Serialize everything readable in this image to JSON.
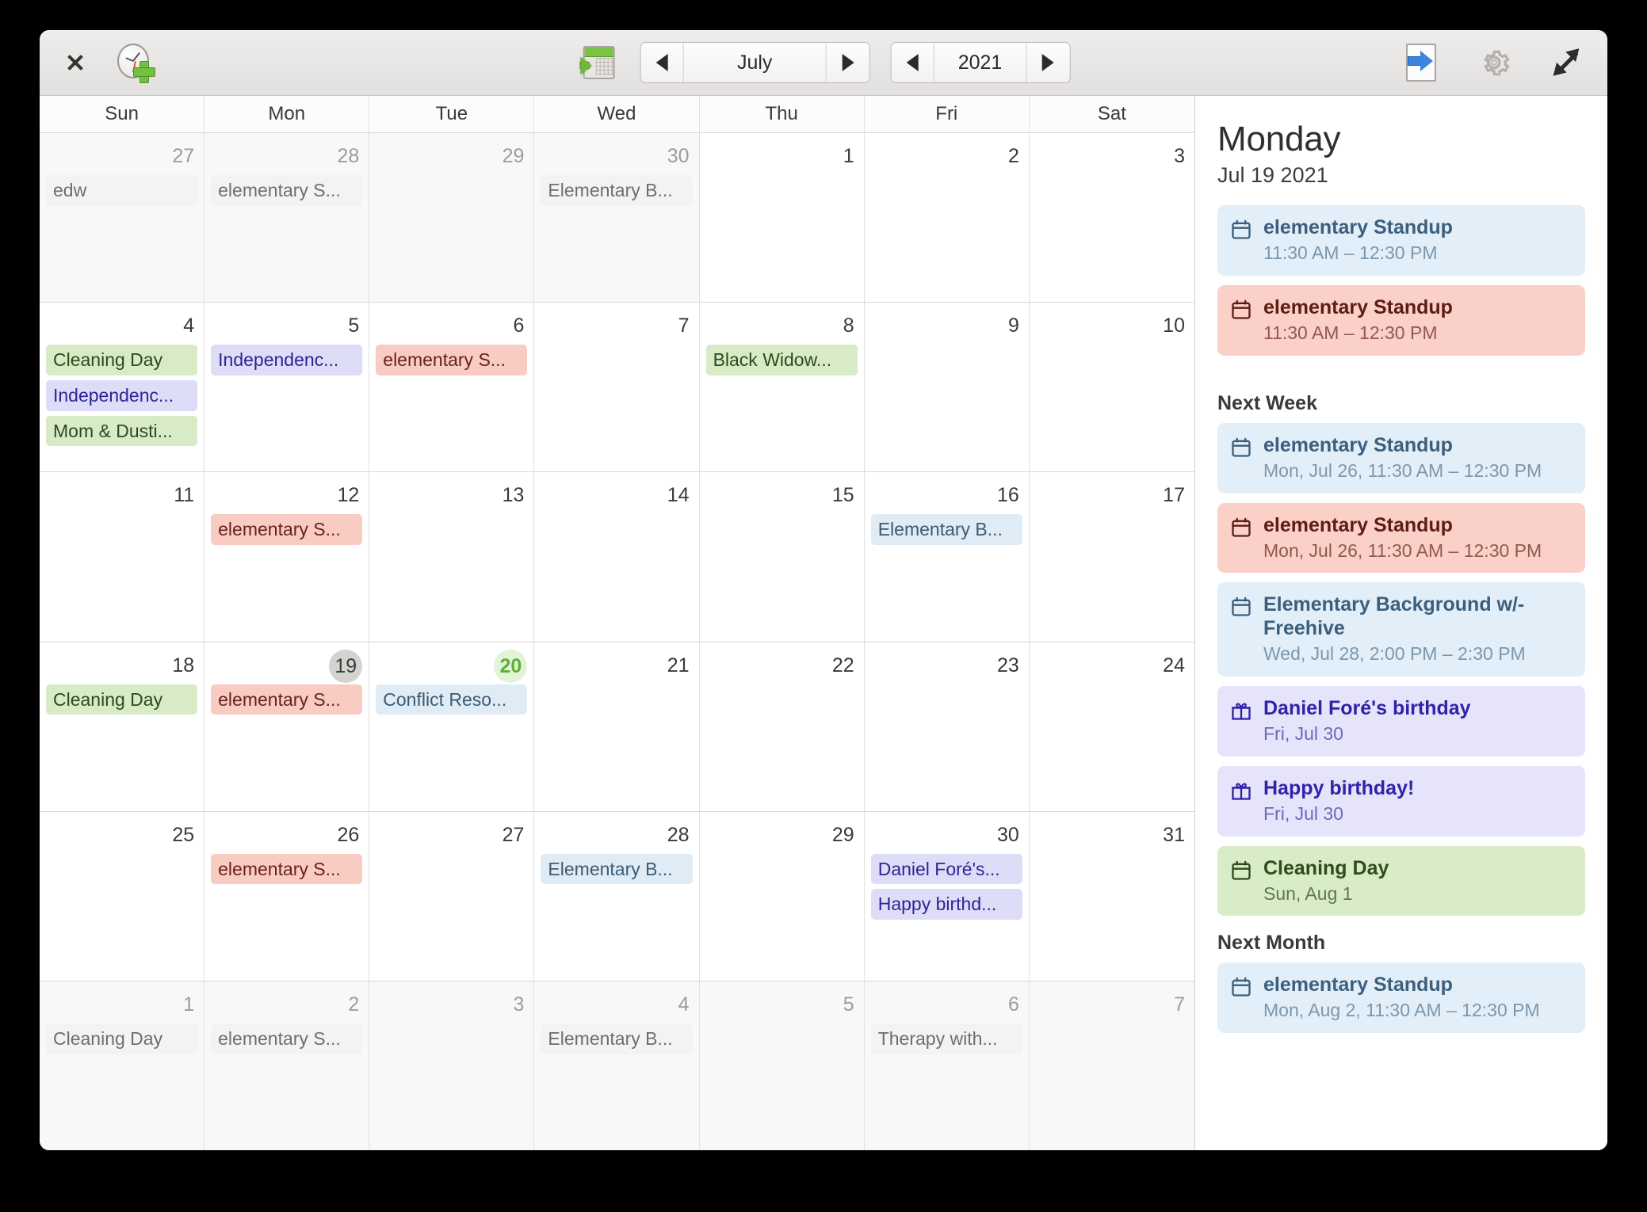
{
  "header": {
    "close_label": "×",
    "add_event_icon": "clock-plus-icon",
    "today_icon": "calendar-arrow-icon",
    "month": "July",
    "year": "2021",
    "prev_month_icon": "chevron-left-icon",
    "next_month_icon": "chevron-right-icon",
    "prev_year_icon": "chevron-left-icon",
    "next_year_icon": "chevron-right-icon",
    "import_icon": "import-icon",
    "settings_icon": "gear-icon",
    "maximize_icon": "expand-icon"
  },
  "calendar": {
    "day_names": [
      "Sun",
      "Mon",
      "Tue",
      "Wed",
      "Thu",
      "Fri",
      "Sat"
    ],
    "weeks": [
      [
        {
          "num": "27",
          "outside": true,
          "events": [
            {
              "title": "edw",
              "color": "muted"
            }
          ]
        },
        {
          "num": "28",
          "outside": true,
          "events": [
            {
              "title": "elementary S...",
              "color": "muted"
            }
          ]
        },
        {
          "num": "29",
          "outside": true,
          "events": []
        },
        {
          "num": "30",
          "outside": true,
          "events": [
            {
              "title": "Elementary B...",
              "color": "muted"
            }
          ]
        },
        {
          "num": "1",
          "outside": false,
          "events": []
        },
        {
          "num": "2",
          "outside": false,
          "events": []
        },
        {
          "num": "3",
          "outside": false,
          "events": []
        }
      ],
      [
        {
          "num": "4",
          "outside": false,
          "events": [
            {
              "title": "Cleaning Day",
              "color": "green"
            },
            {
              "title": "Independenc...",
              "color": "purple"
            },
            {
              "title": "Mom & Dusti...",
              "color": "green"
            }
          ]
        },
        {
          "num": "5",
          "outside": false,
          "events": [
            {
              "title": "Independenc...",
              "color": "purple"
            }
          ]
        },
        {
          "num": "6",
          "outside": false,
          "events": [
            {
              "title": "elementary S...",
              "color": "red"
            }
          ]
        },
        {
          "num": "7",
          "outside": false,
          "events": []
        },
        {
          "num": "8",
          "outside": false,
          "events": [
            {
              "title": "Black Widow...",
              "color": "green"
            }
          ]
        },
        {
          "num": "9",
          "outside": false,
          "events": []
        },
        {
          "num": "10",
          "outside": false,
          "events": []
        }
      ],
      [
        {
          "num": "11",
          "outside": false,
          "events": []
        },
        {
          "num": "12",
          "outside": false,
          "events": [
            {
              "title": "elementary S...",
              "color": "red"
            }
          ]
        },
        {
          "num": "13",
          "outside": false,
          "events": []
        },
        {
          "num": "14",
          "outside": false,
          "events": []
        },
        {
          "num": "15",
          "outside": false,
          "events": []
        },
        {
          "num": "16",
          "outside": false,
          "events": [
            {
              "title": "Elementary B...",
              "color": "blue"
            }
          ]
        },
        {
          "num": "17",
          "outside": false,
          "events": []
        }
      ],
      [
        {
          "num": "18",
          "outside": false,
          "events": [
            {
              "title": "Cleaning Day",
              "color": "green"
            }
          ]
        },
        {
          "num": "19",
          "outside": false,
          "state": "selected",
          "events": [
            {
              "title": "elementary S...",
              "color": "red"
            }
          ]
        },
        {
          "num": "20",
          "outside": false,
          "state": "today",
          "events": [
            {
              "title": "Conflict Reso...",
              "color": "blue"
            }
          ]
        },
        {
          "num": "21",
          "outside": false,
          "events": []
        },
        {
          "num": "22",
          "outside": false,
          "events": []
        },
        {
          "num": "23",
          "outside": false,
          "events": []
        },
        {
          "num": "24",
          "outside": false,
          "events": []
        }
      ],
      [
        {
          "num": "25",
          "outside": false,
          "events": []
        },
        {
          "num": "26",
          "outside": false,
          "events": [
            {
              "title": "elementary S...",
              "color": "red"
            }
          ]
        },
        {
          "num": "27",
          "outside": false,
          "events": []
        },
        {
          "num": "28",
          "outside": false,
          "events": [
            {
              "title": "Elementary B...",
              "color": "blue"
            }
          ]
        },
        {
          "num": "29",
          "outside": false,
          "events": []
        },
        {
          "num": "30",
          "outside": false,
          "events": [
            {
              "title": "Daniel Foré's...",
              "color": "purple"
            },
            {
              "title": "Happy birthd...",
              "color": "purple"
            }
          ]
        },
        {
          "num": "31",
          "outside": false,
          "events": []
        }
      ],
      [
        {
          "num": "1",
          "outside": true,
          "events": [
            {
              "title": "Cleaning Day",
              "color": "muted"
            }
          ]
        },
        {
          "num": "2",
          "outside": true,
          "events": [
            {
              "title": "elementary S...",
              "color": "muted"
            }
          ]
        },
        {
          "num": "3",
          "outside": true,
          "events": []
        },
        {
          "num": "4",
          "outside": true,
          "events": [
            {
              "title": "Elementary B...",
              "color": "muted"
            }
          ]
        },
        {
          "num": "5",
          "outside": true,
          "events": []
        },
        {
          "num": "6",
          "outside": true,
          "events": [
            {
              "title": "Therapy with...",
              "color": "muted"
            }
          ]
        },
        {
          "num": "7",
          "outside": true,
          "events": []
        }
      ]
    ]
  },
  "sidebar": {
    "day_name": "Monday",
    "date": "Jul 19 2021",
    "today_events": [
      {
        "title": "elementary Standup",
        "sub": "11:30 AM – 12:30 PM",
        "color": "blue",
        "icon": "calendar-icon"
      },
      {
        "title": "elementary Standup",
        "sub": "11:30 AM – 12:30 PM",
        "color": "red",
        "icon": "calendar-icon"
      }
    ],
    "next_week_label": "Next Week",
    "next_week_events": [
      {
        "title": "elementary Standup",
        "sub": "Mon, Jul 26, 11:30 AM – 12:30 PM",
        "color": "blue",
        "icon": "calendar-icon"
      },
      {
        "title": "elementary Standup",
        "sub": "Mon, Jul 26, 11:30 AM – 12:30 PM",
        "color": "red",
        "icon": "calendar-icon"
      },
      {
        "title": "Elementary Background w/- Freehive",
        "sub": "Wed, Jul 28, 2:00 PM – 2:30 PM",
        "color": "blue",
        "icon": "calendar-icon"
      },
      {
        "title": "Daniel Foré's birthday",
        "sub": "Fri, Jul 30",
        "color": "purple",
        "icon": "gift-icon"
      },
      {
        "title": "Happy birthday!",
        "sub": "Fri, Jul 30",
        "color": "purple",
        "icon": "gift-icon"
      },
      {
        "title": "Cleaning Day",
        "sub": "Sun, Aug  1",
        "color": "green",
        "icon": "calendar-icon"
      }
    ],
    "next_month_label": "Next Month",
    "next_month_events": [
      {
        "title": "elementary Standup",
        "sub": "Mon, Aug  2, 11:30 AM – 12:30 PM",
        "color": "blue",
        "icon": "calendar-icon"
      }
    ]
  },
  "colors": {
    "green": "#d7ecc6",
    "purple": "#deddf8",
    "red": "#f8cbc3",
    "blue": "#dfebf5",
    "today_accent": "#5cb033"
  }
}
